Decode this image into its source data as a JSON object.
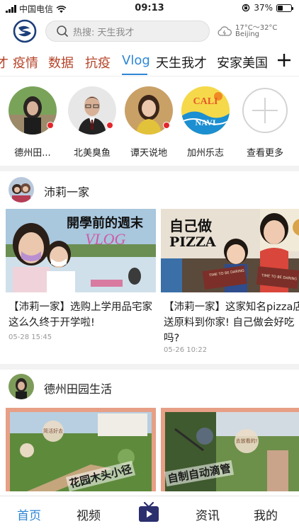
{
  "status_bar": {
    "carrier": "中国电信",
    "time": "09:13",
    "battery": "37%",
    "battery_level": 0.37
  },
  "header": {
    "search_placeholder": "热搜: 天生我才",
    "weather_temp": "17°C～32°C",
    "weather_city": "Beijing",
    "icons": [
      "logo",
      "search-icon",
      "cloud-icon"
    ]
  },
  "tabs": [
    {
      "label": "才",
      "style": "hot"
    },
    {
      "label": "疫情",
      "style": "hot"
    },
    {
      "label": "数据",
      "style": "hot"
    },
    {
      "label": "抗疫",
      "style": "hot"
    },
    {
      "label": "Vlog",
      "style": "active"
    },
    {
      "label": "天生我才",
      "style": "normal"
    },
    {
      "label": "安家美国",
      "style": "normal"
    },
    {
      "label": "+",
      "style": "more"
    }
  ],
  "avatars": [
    {
      "label": "德州田..."
    },
    {
      "label": "北美臭鱼"
    },
    {
      "label": "谭天说地"
    },
    {
      "label": "加州乐志",
      "logo_line1": "CALI",
      "logo_line2": "NAVI"
    },
    {
      "label": "查看更多"
    }
  ],
  "sections": [
    {
      "author": "沛莉一家",
      "cards": [
        {
          "thumb_text": "開學前的週末",
          "thumb_script": "VLOG",
          "title": "【沛莉一家】选购上学用品宅家这么久终于开学啦!",
          "date": "05-28 15:45"
        },
        {
          "thumb_text_line1": "自己做",
          "thumb_text_line2": "PIZZA",
          "thumb_badge_left": "TIME TO BE DARING",
          "thumb_badge_right": "TIME TO BE DARING",
          "title": "【沛莉一家】这家知名pizza店送原料到你家! 自己做会好吃吗?",
          "date": "05-26 10:22"
        }
      ]
    },
    {
      "author": "德州田园生活",
      "cards": [
        {
          "thumb_stamp": "简活好去",
          "thumb_text": "花园木头小径"
        },
        {
          "thumb_stamp": "去放看的!",
          "thumb_text": "自制自动滴管"
        }
      ]
    }
  ],
  "bottom_nav": [
    {
      "label": "首页",
      "active": true
    },
    {
      "label": "视频",
      "active": false
    },
    {
      "label": "",
      "icon": "tv-icon"
    },
    {
      "label": "资讯",
      "active": false
    },
    {
      "label": "我的",
      "active": false
    }
  ],
  "colors": {
    "accent": "#2d86d6",
    "hot_tab": "#b6452a",
    "live_dot": "#e3262c"
  }
}
